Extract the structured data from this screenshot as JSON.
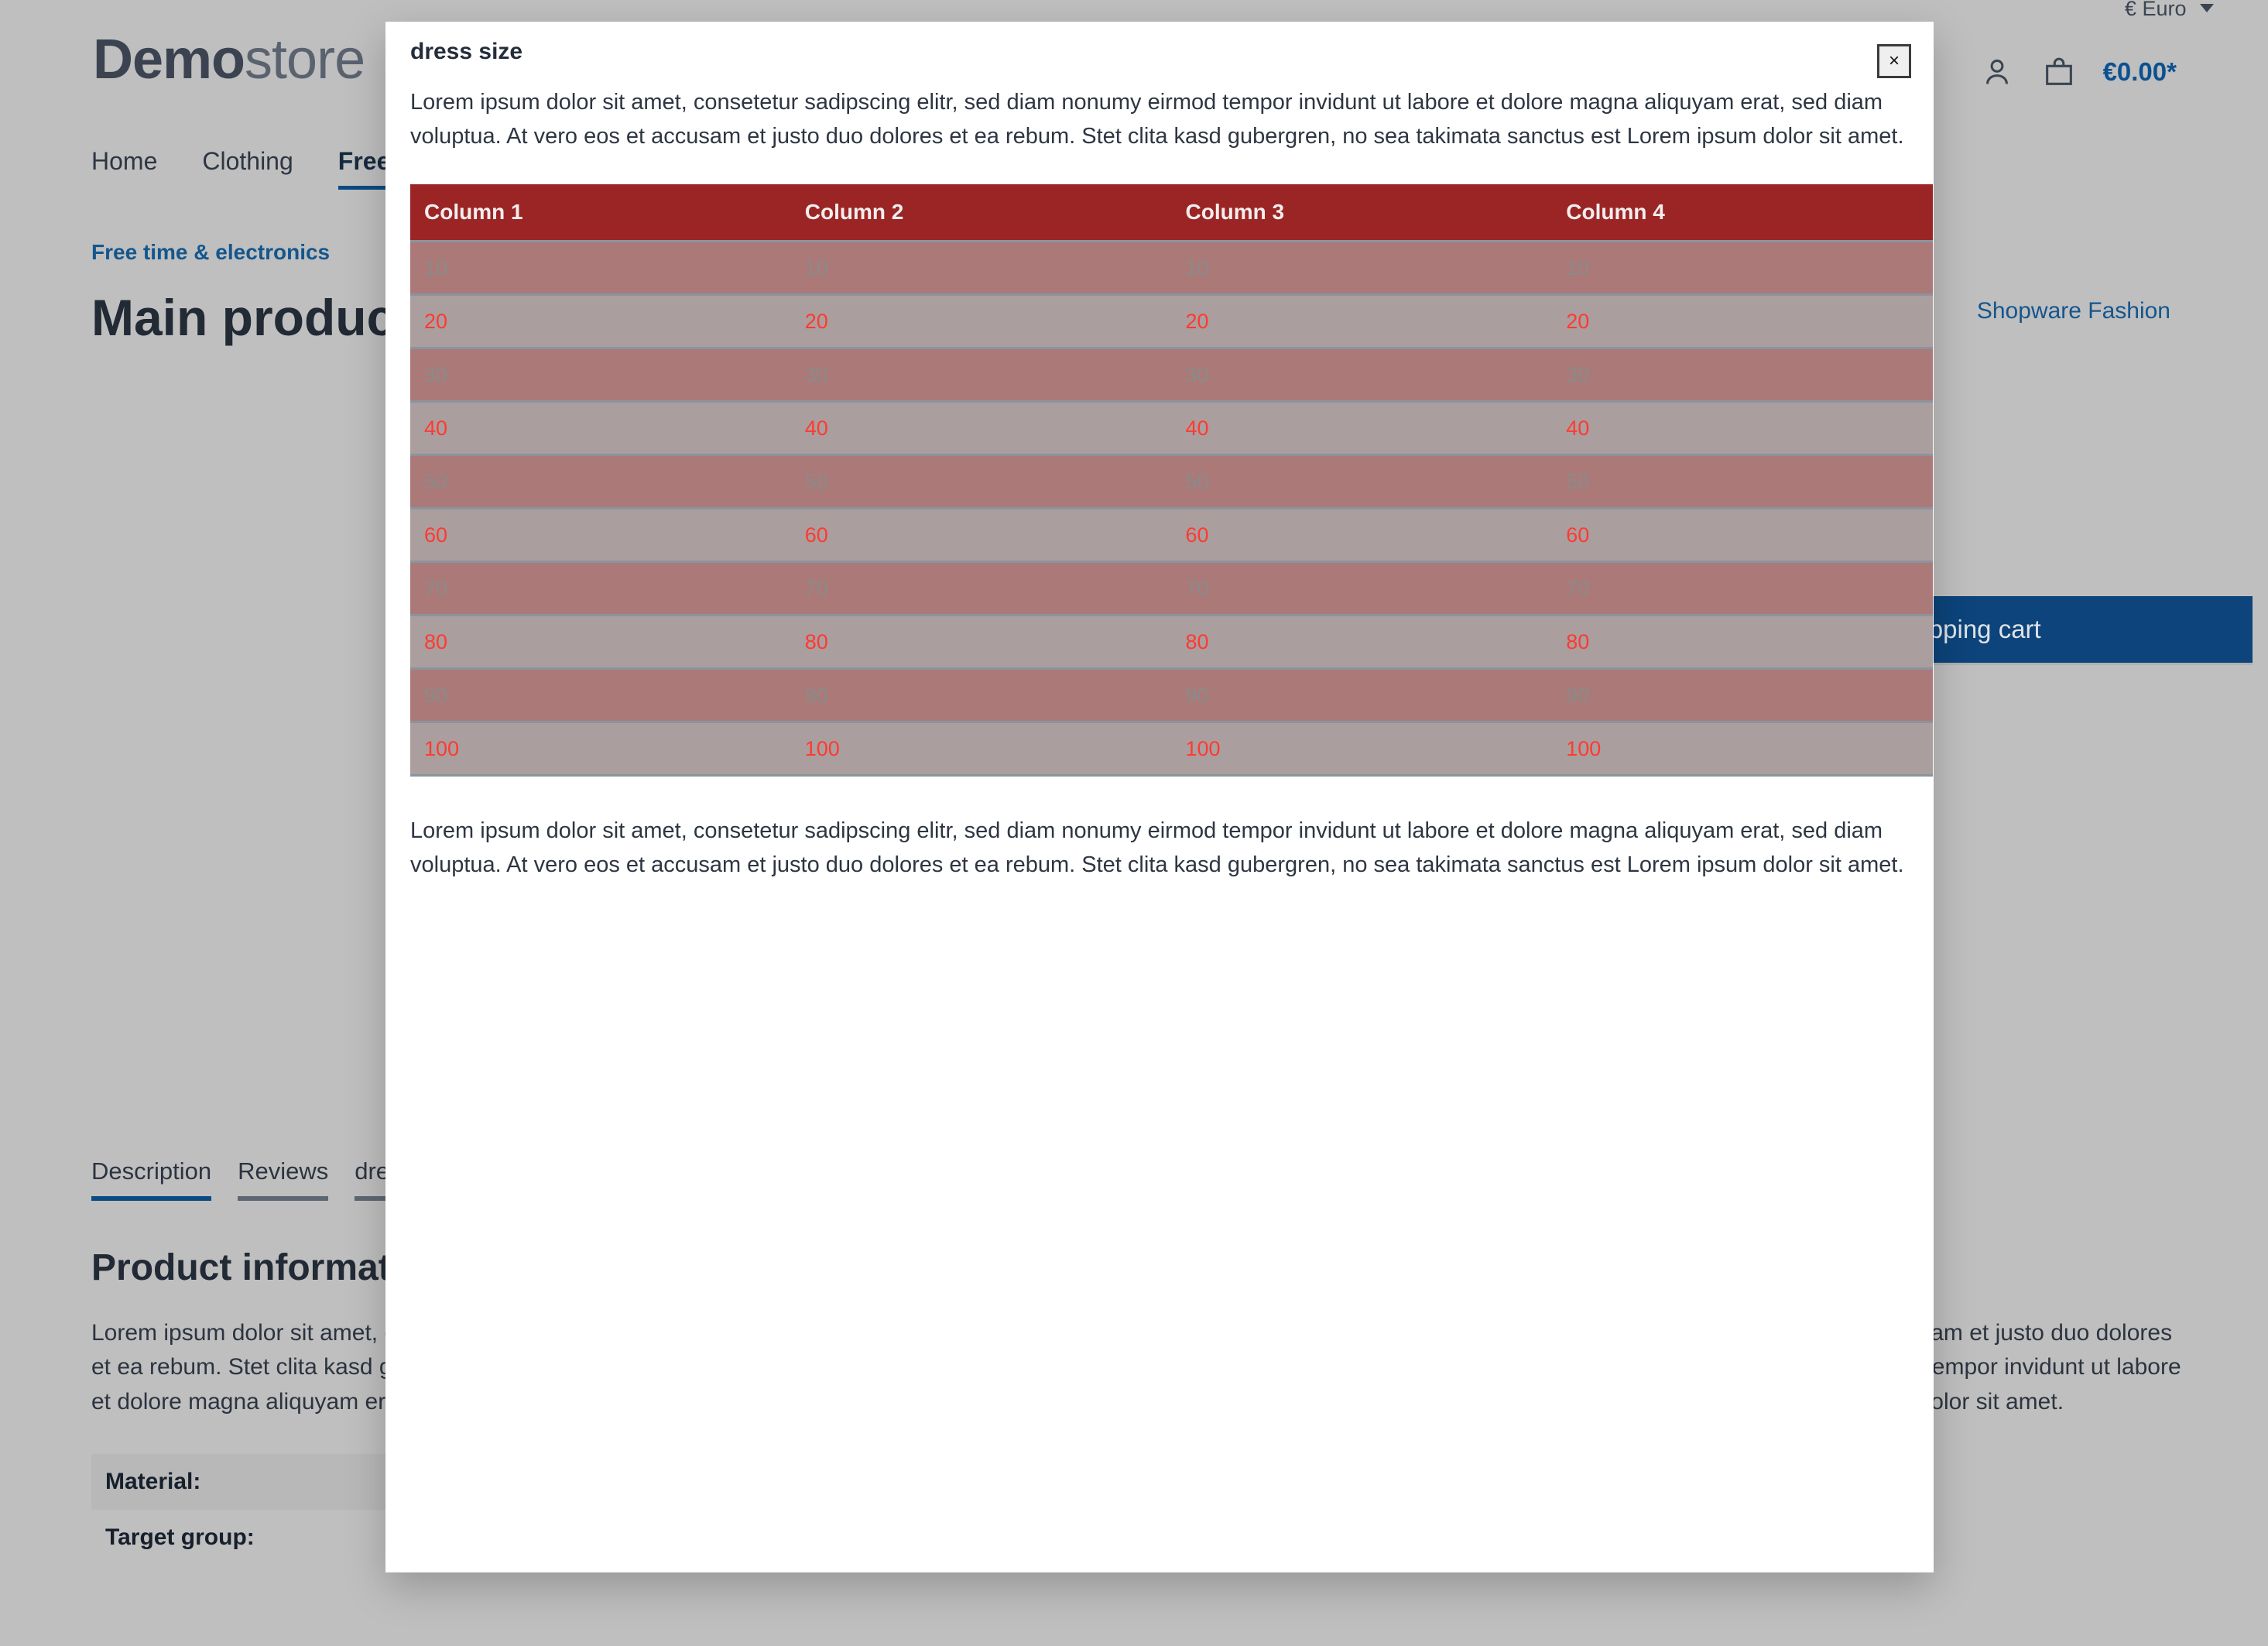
{
  "background": {
    "topbar": {
      "currency": "€ Euro"
    },
    "logo": {
      "bold": "Demo",
      "thin": "store"
    },
    "header": {
      "account_icon": "user-icon",
      "cart_icon": "shopping-bag-icon",
      "cart_total": "€0.00*"
    },
    "nav": [
      {
        "label": "Home",
        "active": false
      },
      {
        "label": "Clothing",
        "active": false
      },
      {
        "label": "Free time & electronics",
        "active": true
      }
    ],
    "breadcrumb": "Free time & electronics",
    "product_title": "Main product with review",
    "manufacturer_link": "Shopware Fashion",
    "buy_button": "Add to shopping cart",
    "tabs": [
      {
        "label": "Description",
        "active": true
      },
      {
        "label": "Reviews",
        "active": false
      },
      {
        "label": "dress size",
        "active": false
      }
    ],
    "section_title": "Product information",
    "section_body": "Lorem ipsum dolor sit amet, consetetur sadipscing elitr, sed diam nonumy eirmod tempor invidunt ut labore et dolore magna aliquyam erat, sed diam voluptua. At vero eos et accusam et justo duo dolores et ea rebum. Stet clita kasd gubergren, no sea takimata sanctus est Lorem ipsum dolor sit amet. Lorem ipsum dolor sit amet, consetetur sadipscing elitr, sed diam nonumy eirmod tempor invidunt ut labore et dolore magna aliquyam erat, sed diam voluptua. At vero eos et accusam et justo duo dolores et ea rebum. Stet clita kasd gubergren, no sea takimata sanctus est Lorem ipsum dolor sit amet.",
    "properties": [
      {
        "label": "Material:"
      },
      {
        "label": "Target group:"
      }
    ]
  },
  "modal": {
    "title": "dress size",
    "close_label": "×",
    "paragraph_top": "Lorem ipsum dolor sit amet, consetetur sadipscing elitr, sed diam nonumy eirmod tempor invidunt ut labore et dolore magna aliquyam erat, sed diam voluptua. At vero eos et accusam et justo duo dolores et ea rebum. Stet clita kasd gubergren, no sea takimata sanctus est Lorem ipsum dolor sit amet.",
    "paragraph_bottom": "Lorem ipsum dolor sit amet, consetetur sadipscing elitr, sed diam nonumy eirmod tempor invidunt ut labore et dolore magna aliquyam erat, sed diam voluptua. At vero eos et accusam et justo duo dolores et ea rebum. Stet clita kasd gubergren, no sea takimata sanctus est Lorem ipsum dolor sit amet."
  },
  "colors": {
    "table_header_bg": "#9b2525",
    "table_header_text": "#f3eeee",
    "row_odd_bg": "#ab7a78",
    "row_odd_text": "#8a8a8a",
    "row_even_bg": "#ab9e9e",
    "row_even_text": "#ff3a30",
    "row_border": "#8b939e",
    "accent_blue": "#0b4b82",
    "page_bg": "#bfbfbf"
  },
  "chart_data": {
    "type": "table",
    "title": "dress size",
    "columns": [
      "Column 1",
      "Column 2",
      "Column 3",
      "Column 4"
    ],
    "rows": [
      [
        "10",
        "10",
        "10",
        "10"
      ],
      [
        "20",
        "20",
        "20",
        "20"
      ],
      [
        "30",
        "30",
        "30",
        "30"
      ],
      [
        "40",
        "40",
        "40",
        "40"
      ],
      [
        "50",
        "50",
        "50",
        "50"
      ],
      [
        "60",
        "60",
        "60",
        "60"
      ],
      [
        "70",
        "70",
        "70",
        "70"
      ],
      [
        "80",
        "80",
        "80",
        "80"
      ],
      [
        "90",
        "90",
        "90",
        "90"
      ],
      [
        "100",
        "100",
        "100",
        "100"
      ]
    ]
  }
}
